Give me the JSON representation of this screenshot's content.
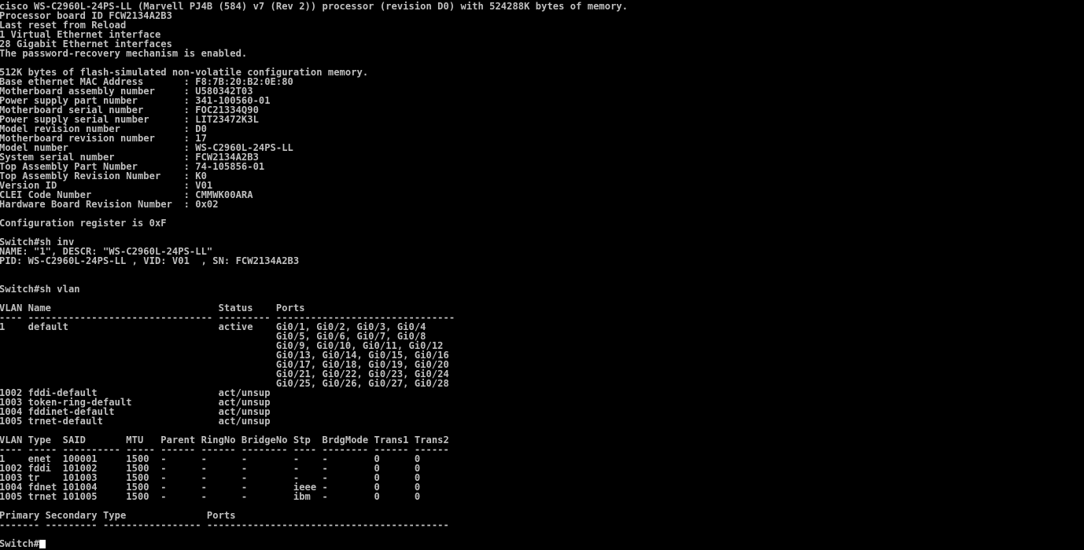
{
  "terminal": {
    "lines": [
      "cisco WS-C2960L-24PS-LL (Marvell PJ4B (584) v7 (Rev 2)) processor (revision D0) with 524288K bytes of memory.",
      "Processor board ID FCW2134A2B3",
      "Last reset from Reload",
      "1 Virtual Ethernet interface",
      "28 Gigabit Ethernet interfaces",
      "The password-recovery mechanism is enabled.",
      "",
      "512K bytes of flash-simulated non-volatile configuration memory.",
      "Base ethernet MAC Address       : F8:7B:20:B2:0E:80",
      "Motherboard assembly number     : U580342T03",
      "Power supply part number        : 341-100560-01",
      "Motherboard serial number       : FOC21334Q90",
      "Power supply serial number      : LIT23472K3L",
      "Model revision number           : D0",
      "Motherboard revision number     : 17",
      "Model number                    : WS-C2960L-24PS-LL",
      "System serial number            : FCW2134A2B3",
      "Top Assembly Part Number        : 74-105856-01",
      "Top Assembly Revision Number    : K0",
      "Version ID                      : V01",
      "CLEI Code Number                : CMMWK00ARA",
      "Hardware Board Revision Number  : 0x02",
      "",
      "Configuration register is 0xF",
      "",
      "Switch#sh inv",
      "NAME: \"1\", DESCR: \"WS-C2960L-24PS-LL\"",
      "PID: WS-C2960L-24PS-LL , VID: V01  , SN: FCW2134A2B3",
      "",
      "",
      "Switch#sh vlan",
      "",
      "VLAN Name                             Status    Ports",
      "---- -------------------------------- --------- -------------------------------",
      "1    default                          active    Gi0/1, Gi0/2, Gi0/3, Gi0/4",
      "                                                Gi0/5, Gi0/6, Gi0/7, Gi0/8",
      "                                                Gi0/9, Gi0/10, Gi0/11, Gi0/12",
      "                                                Gi0/13, Gi0/14, Gi0/15, Gi0/16",
      "                                                Gi0/17, Gi0/18, Gi0/19, Gi0/20",
      "                                                Gi0/21, Gi0/22, Gi0/23, Gi0/24",
      "                                                Gi0/25, Gi0/26, Gi0/27, Gi0/28",
      "1002 fddi-default                     act/unsup",
      "1003 token-ring-default               act/unsup",
      "1004 fddinet-default                  act/unsup",
      "1005 trnet-default                    act/unsup",
      "",
      "VLAN Type  SAID       MTU   Parent RingNo BridgeNo Stp  BrdgMode Trans1 Trans2",
      "---- ----- ---------- ----- ------ ------ -------- ---- -------- ------ ------",
      "1    enet  100001     1500  -      -      -        -    -        0      0",
      "1002 fddi  101002     1500  -      -      -        -    -        0      0",
      "1003 tr    101003     1500  -      -      -        -    -        0      0",
      "1004 fdnet 101004     1500  -      -      -        ieee -        0      0",
      "1005 trnet 101005     1500  -      -      -        ibm  -        0      0",
      "",
      "Primary Secondary Type              Ports",
      "------- --------- ----------------- ------------------------------------------",
      ""
    ],
    "prompt": "Switch#"
  }
}
